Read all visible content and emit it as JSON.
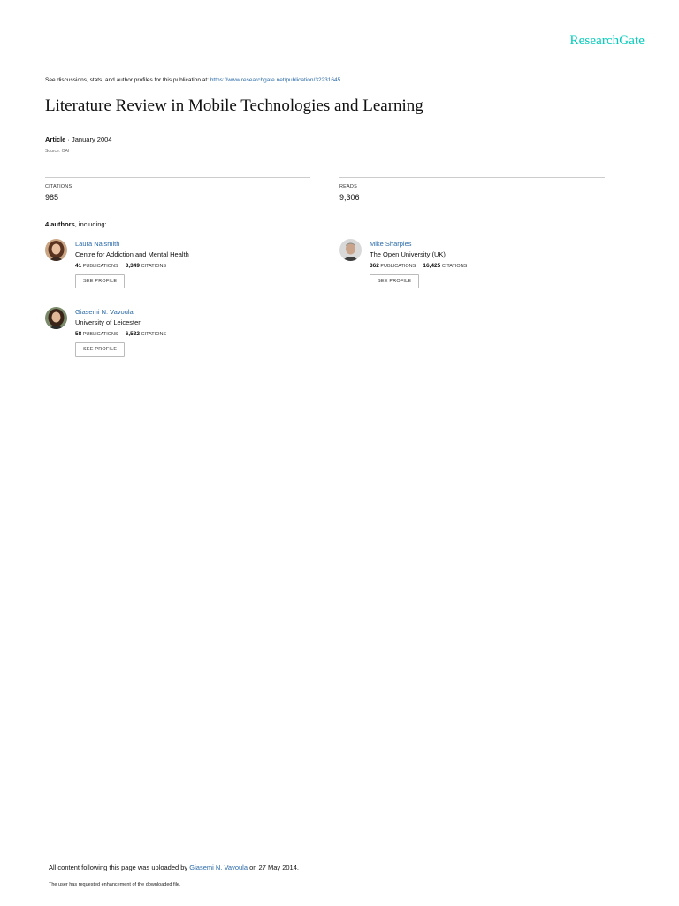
{
  "brand": {
    "logo": "ResearchGate",
    "accent_color": "#00ccbb",
    "link_color": "#2a6aa8"
  },
  "header": {
    "discuss_text": "See discussions, stats, and author profiles for this publication at:",
    "publication_url": "https://www.researchgate.net/publication/32231645"
  },
  "article": {
    "title": "Literature Review in Mobile Technologies and Learning",
    "type": "Article",
    "separator": " · ",
    "date": "January 2004",
    "source": "Source: OAI"
  },
  "stats": {
    "citations_label": "CITATIONS",
    "citations_value": "985",
    "reads_label": "READS",
    "reads_value": "9,306"
  },
  "authors_summary": {
    "count": "4 authors",
    "suffix": ", including:"
  },
  "authors": [
    {
      "name": "Laura Naismith",
      "institution": "Centre for Addiction and Mental Health",
      "publications": "41",
      "publications_label": "PUBLICATIONS",
      "citations": "3,349",
      "citations_label": "CITATIONS",
      "button": "SEE PROFILE",
      "avatar_icon": "woman-portrait-icon"
    },
    {
      "name": "Mike Sharples",
      "institution": "The Open University (UK)",
      "publications": "362",
      "publications_label": "PUBLICATIONS",
      "citations": "16,425",
      "citations_label": "CITATIONS",
      "button": "SEE PROFILE",
      "avatar_icon": "man-portrait-icon"
    },
    {
      "name": "Giasemi N. Vavoula",
      "institution": "University of Leicester",
      "publications": "58",
      "publications_label": "PUBLICATIONS",
      "citations": "6,532",
      "citations_label": "CITATIONS",
      "button": "SEE PROFILE",
      "avatar_icon": "woman-portrait-icon"
    }
  ],
  "footer": {
    "upload_prefix": "All content following this page was uploaded by",
    "uploader": "Giasemi N. Vavoula",
    "upload_suffix": "on 27 May 2014.",
    "enhancement_note": "The user has requested enhancement of the downloaded file."
  }
}
